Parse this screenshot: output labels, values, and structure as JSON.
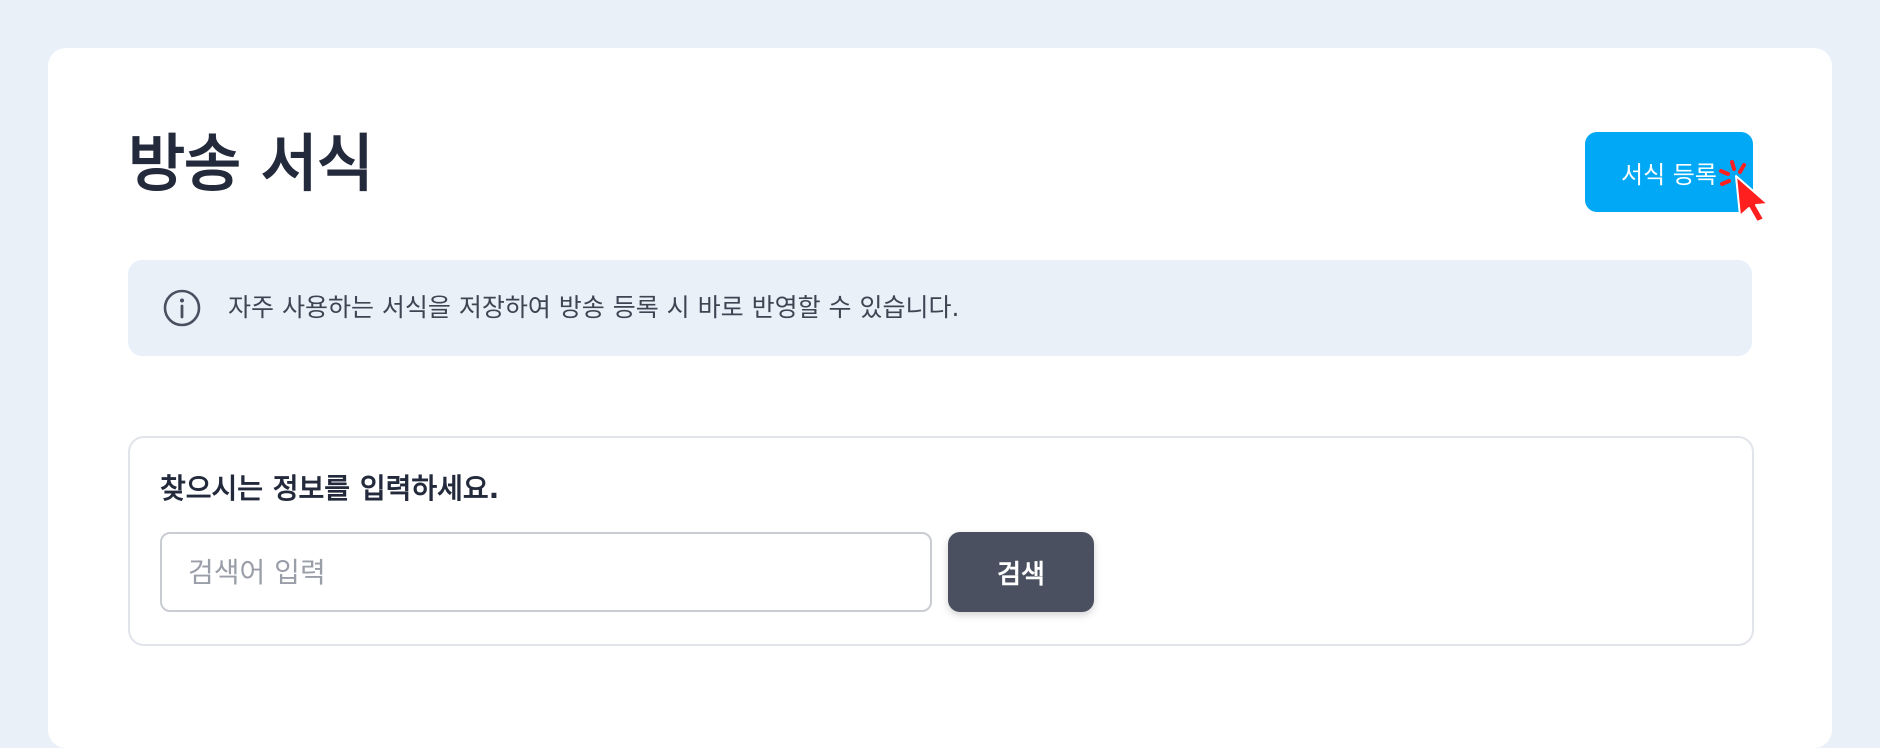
{
  "header": {
    "title": "방송 서식",
    "register_button_label": "서식 등록"
  },
  "notice": {
    "icon": "info-icon",
    "text": "자주 사용하는 서식을 저장하여 방송 등록 시 바로 반영할 수 있습니다."
  },
  "search": {
    "label": "찾으시는 정보를 입력하세요.",
    "input_value": "",
    "input_placeholder": "검색어 입력",
    "button_label": "검색"
  },
  "colors": {
    "page_background": "#e9f0f8",
    "primary_accent": "#00a8f5",
    "search_button": "#4a5060",
    "title_text": "#232a3c",
    "cursor": "#ff1f1f"
  }
}
